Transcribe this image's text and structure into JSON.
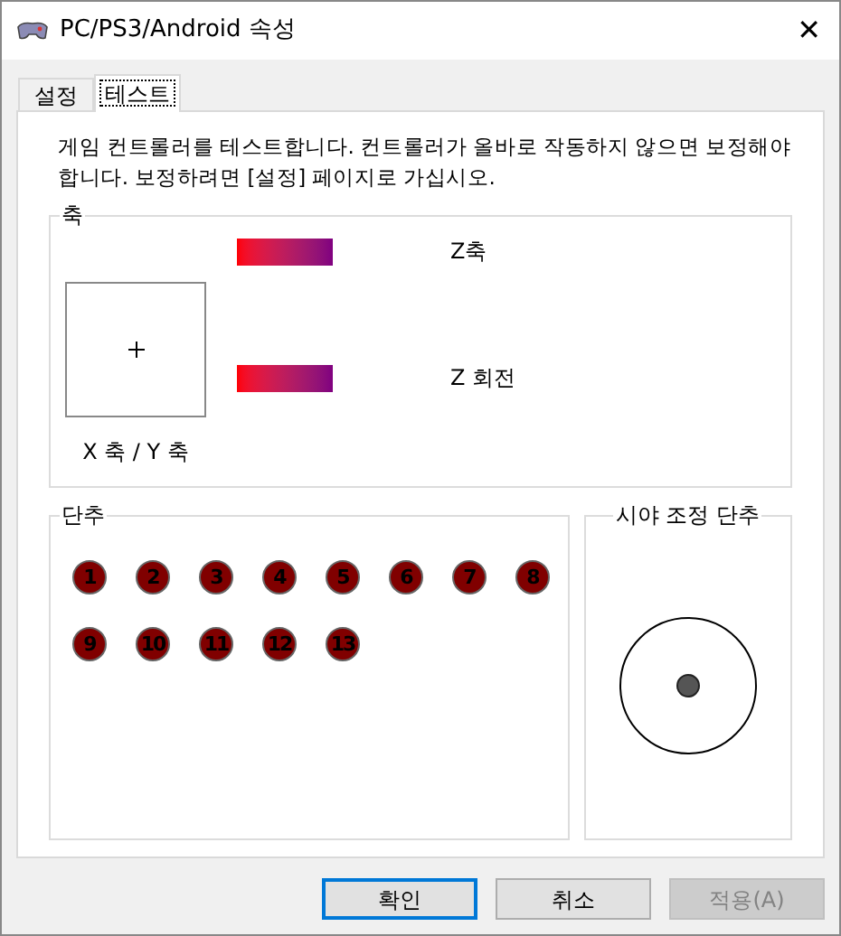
{
  "window": {
    "title": "PC/PS3/Android 속성",
    "close": "✕"
  },
  "tabs": [
    {
      "label": "설정",
      "selected": false
    },
    {
      "label": "테스트",
      "selected": true
    }
  ],
  "description": "게임 컨트롤러를 테스트합니다. 컨트롤러가 올바로 작동하지 않으면 보정해야 합니다. 보정하려면 [설정] 페이지로 가십시오.",
  "axes": {
    "title": "축",
    "xy_label": "X 축 / Y 축",
    "bars": [
      {
        "label": "Z축"
      },
      {
        "label": "Z 회전"
      }
    ]
  },
  "buttons_group": {
    "title": "단추",
    "buttons": [
      "1",
      "2",
      "3",
      "4",
      "5",
      "6",
      "7",
      "8",
      "9",
      "10",
      "11",
      "12",
      "13"
    ]
  },
  "pov": {
    "title": "시야 조정 단추"
  },
  "dialog_buttons": [
    {
      "label": "확인",
      "default": true,
      "disabled": false
    },
    {
      "label": "취소",
      "default": false,
      "disabled": false
    },
    {
      "label": "적용(A)",
      "default": false,
      "disabled": true
    }
  ]
}
